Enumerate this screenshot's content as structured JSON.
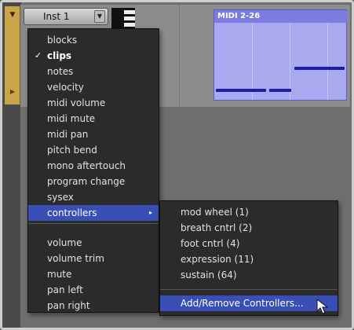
{
  "track": {
    "name": "Inst 1",
    "region_name": "MIDI 2-26"
  },
  "view_menu": {
    "items": [
      {
        "label": "blocks",
        "checked": false
      },
      {
        "label": "clips",
        "checked": true
      },
      {
        "label": "notes",
        "checked": false
      },
      {
        "label": "velocity",
        "checked": false
      },
      {
        "label": "midi volume",
        "checked": false
      },
      {
        "label": "midi mute",
        "checked": false
      },
      {
        "label": "midi pan",
        "checked": false
      },
      {
        "label": "pitch bend",
        "checked": false
      },
      {
        "label": "mono aftertouch",
        "checked": false
      },
      {
        "label": "program change",
        "checked": false
      },
      {
        "label": "sysex",
        "checked": false
      },
      {
        "label": "controllers",
        "checked": false,
        "has_submenu": true,
        "selected": true
      }
    ],
    "items_after_separator": [
      {
        "label": "volume"
      },
      {
        "label": "volume trim"
      },
      {
        "label": "mute"
      },
      {
        "label": "pan left"
      },
      {
        "label": "pan right"
      }
    ],
    "check_glyph": "✓",
    "submenu_glyph": "▸"
  },
  "controllers_submenu": {
    "items": [
      {
        "label": "mod wheel (1)"
      },
      {
        "label": "breath cntrl (2)"
      },
      {
        "label": "foot cntrl (4)"
      },
      {
        "label": "expression (11)"
      },
      {
        "label": "sustain (64)"
      }
    ],
    "action": {
      "label": "Add/Remove Controllers...",
      "selected": true
    }
  },
  "colors": {
    "menu_bg": "#2b2b2b",
    "selection": "#3a4fb6",
    "region": "#a9a9f0",
    "notes": "#1c1ca8",
    "track_color": "#c8a44a"
  },
  "icons": {
    "track_expand": "chevron-down-icon",
    "track_play": "play-triangle-icon",
    "select_dropdown": "chevron-down-icon",
    "cursor": "mouse-pointer-icon"
  }
}
